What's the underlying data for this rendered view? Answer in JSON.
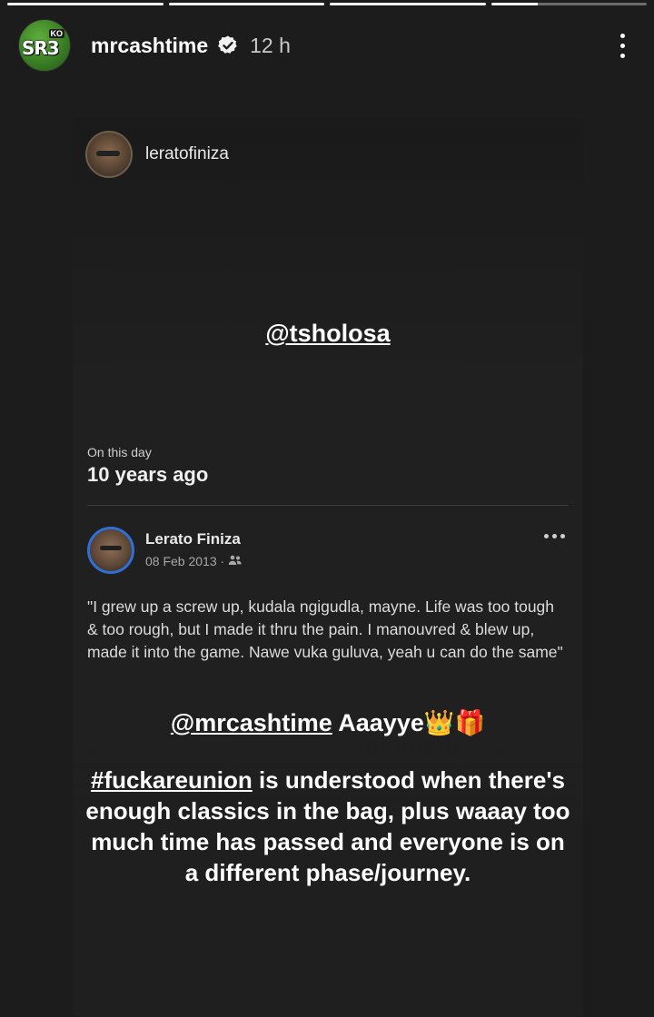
{
  "story": {
    "progress": [
      1,
      1,
      1,
      0.3
    ],
    "username": "mrcashtime",
    "time_ago": "12 h",
    "avatar_logo": "SR3",
    "avatar_tag": "KO",
    "icons": {
      "verified": "verified-badge-icon",
      "more": "more-vertical-icon"
    }
  },
  "shared_post": {
    "username": "leratofiniza",
    "mention": "@tsholosa",
    "memory_label": "On this day",
    "memory_time": "10 years ago",
    "fb": {
      "name": "Lerato Finiza",
      "date": "08 Feb 2013 ·",
      "audience_icon": "friends-icon",
      "more_icon": "more-horizontal-icon",
      "text": "\"I grew up a screw up, kudala ngigudla, mayne. Life was too tough & too rough, but I made it thru the pain. I manouvred & blew up, made it into the game. Nawe vuka guluva, yeah u can do the same\""
    }
  },
  "caption": {
    "mention": "@mrcashtime",
    "line1_rest": " Aaayye👑🎁",
    "hashtag": "#fuckareunion",
    "line2_rest": " is understood when there's enough classics in the bag, plus waaay too much time has passed and everyone is on a different phase/journey."
  }
}
